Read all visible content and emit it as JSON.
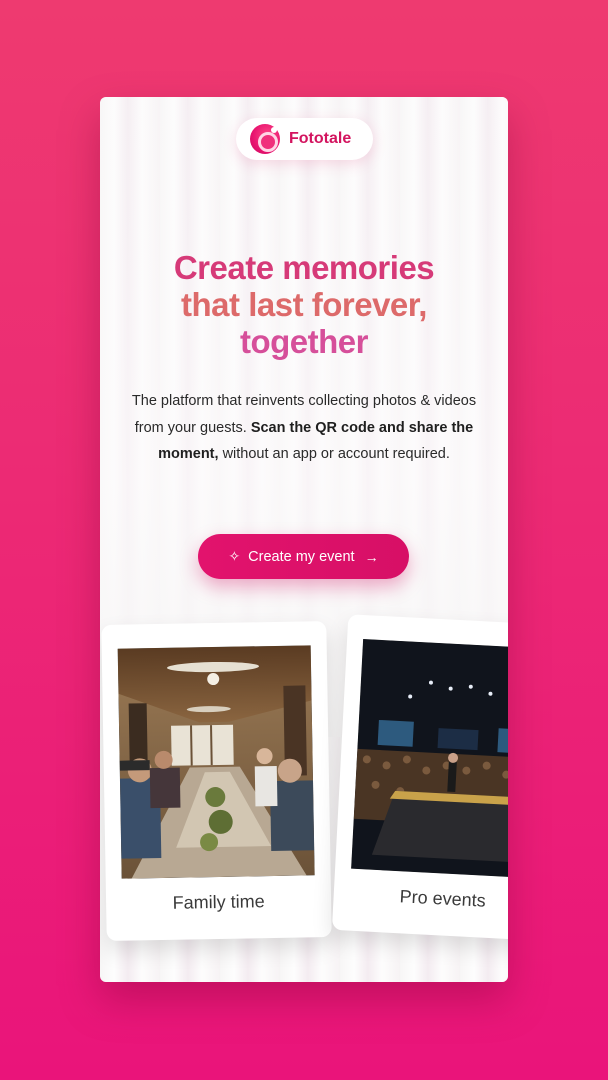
{
  "brand": {
    "name": "Fototale",
    "logo_icon": "camera-lens-icon"
  },
  "hero": {
    "headline_line1": "Create memories",
    "headline_line2": "that last forever,",
    "headline_line3": "together",
    "description_part1": "The platform that reinvents collecting photos & videos from your guests.",
    "description_bold": "Scan the QR code and share the moment,",
    "description_part2": "without an app or account required."
  },
  "cta": {
    "label": "Create my event",
    "icon": "sparkle-icon",
    "arrow": "arrow-right-icon"
  },
  "cards": [
    {
      "label": "Family time"
    },
    {
      "label": "Pro events"
    }
  ],
  "colors": {
    "background": "#ec2a74",
    "accent": "#e2136d",
    "headline_pink": "#d63a78",
    "headline_coral": "#dd6a6a"
  }
}
